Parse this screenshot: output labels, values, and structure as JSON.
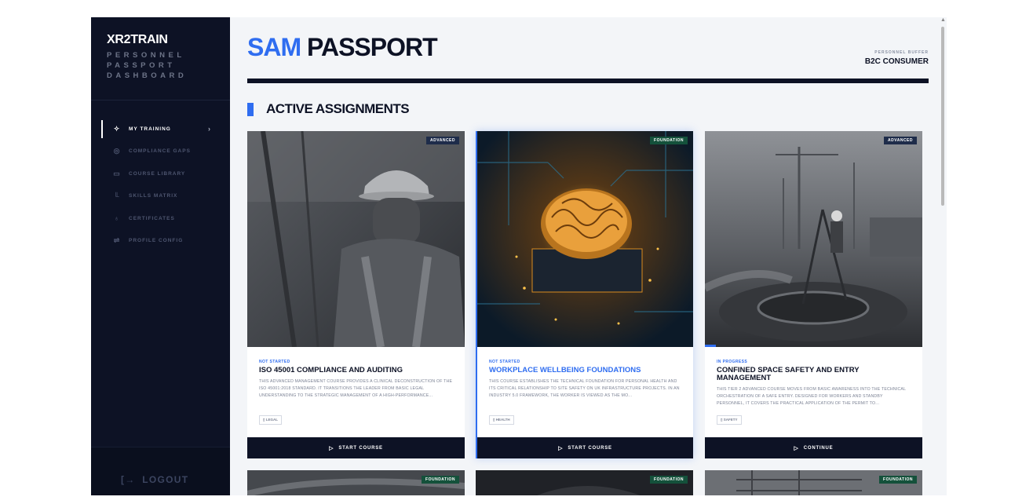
{
  "brand": {
    "name": "XR2TRAIN",
    "subtitle": "PERSONNEL PASSPORT DASHBOARD"
  },
  "nav": [
    {
      "label": "MY TRAINING",
      "icon": "sparkle-icon",
      "active": true
    },
    {
      "label": "COMPLIANCE GAPS",
      "icon": "target-icon"
    },
    {
      "label": "COURSE LIBRARY",
      "icon": "book-icon"
    },
    {
      "label": "SKILLS MATRIX",
      "icon": "bar-chart-icon"
    },
    {
      "label": "CERTIFICATES",
      "icon": "award-icon"
    },
    {
      "label": "PROFILE CONFIG",
      "icon": "sliders-icon"
    }
  ],
  "logout": {
    "label": "LOGOUT"
  },
  "header": {
    "title_accent": "SAM",
    "title_rest": "PASSPORT",
    "meta_label": "PERSONNEL BUFFER",
    "meta_value": "B2C CONSUMER"
  },
  "section": {
    "title": "ACTIVE ASSIGNMENTS"
  },
  "cards": [
    {
      "badge": "ADVANCED",
      "status": "NOT STARTED",
      "title": "ISO 45001 COMPLIANCE AND AUDITING",
      "description": "THIS ADVANCED MANAGEMENT COURSE PROVIDES A CLINICAL DECONSTRUCTION OF THE ISO 45001:2018 STANDARD. IT TRANSITIONS THE LEADER FROM BASIC LEGAL UNDERSTANDING TO THE STRATEGIC MANAGEMENT OF A HIGH-PERFORMANCE...",
      "tag": "LEGAL",
      "button": "START COURSE",
      "image": "worker-hardhat-photo"
    },
    {
      "badge": "FOUNDATION",
      "status": "NOT STARTED",
      "title": "WORKPLACE WELLBEING FOUNDATIONS",
      "description": "THIS COURSE ESTABLISHES THE TECHNICAL FOUNDATION FOR PERSONAL HEALTH AND ITS CRITICAL RELATIONSHIP TO SITE SAFETY ON UK INFRASTRUCTURE PROJECTS. IN AN INDUSTRY 5.0 FRAMEWORK, THE WORKER IS VIEWED AS THE MO...",
      "tag": "HEALTH",
      "button": "START COURSE",
      "image": "circuit-brain-photo"
    },
    {
      "badge": "ADVANCED",
      "status": "IN PROGRESS",
      "title": "CONFINED SPACE SAFETY AND ENTRY MANAGEMENT",
      "description": "THIS TIER 2 ADVANCED COURSE MOVES FROM BASIC AWARENESS INTO THE TECHNICAL ORCHESTRATION OF A SAFE ENTRY. DESIGNED FOR WORKERS AND STANDBY PERSONNEL, IT COVERS THE PRACTICAL APPLICATION OF THE PERMIT TO...",
      "tag": "SAFETY",
      "button": "CONTINUE",
      "progress": 0.05,
      "image": "construction-site-photo"
    }
  ],
  "row2_badges": [
    "FOUNDATION",
    "FOUNDATION",
    "FOUNDATION"
  ],
  "colors": {
    "accent": "#2f6df0",
    "navy": "#0d1225",
    "foundation": "#14513b",
    "advanced": "#1e2c4a"
  }
}
